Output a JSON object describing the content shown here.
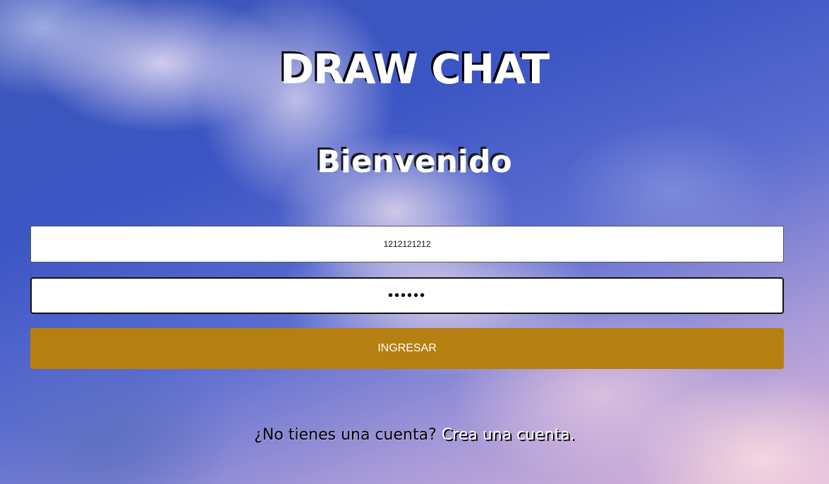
{
  "app": {
    "title": "DRAW CHAT",
    "welcome": "Bienvenido"
  },
  "login_form": {
    "username_value": "1212121212",
    "password_value": "123456",
    "submit_label": "INGRESAR"
  },
  "footer": {
    "prompt": "¿No tienes una cuenta?",
    "link_label": "Crea una cuenta."
  },
  "colors": {
    "submit_button": "#b57f11",
    "text_white": "#ffffff",
    "text_black": "#000000"
  }
}
